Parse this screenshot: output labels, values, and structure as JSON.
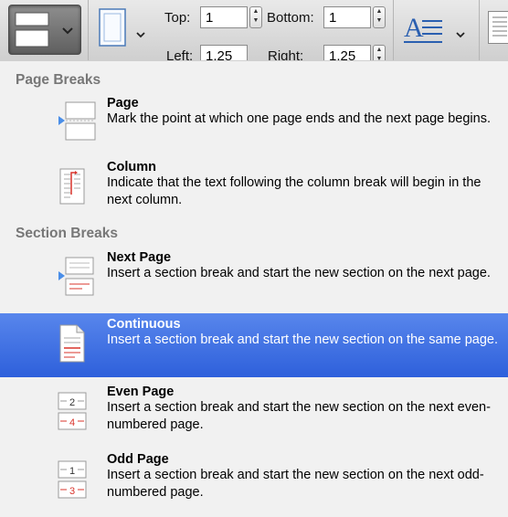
{
  "toolbar": {
    "top_label": "Top:",
    "top_value": "1",
    "bottom_label": "Bottom:",
    "bottom_value": "1",
    "left_label": "Left:",
    "left_value": "1.25",
    "right_label": "Right:",
    "right_value": "1.25"
  },
  "menu": {
    "page_breaks_header": "Page Breaks",
    "section_breaks_header": "Section Breaks",
    "items": [
      {
        "title": "Page",
        "desc": "Mark the point at which one page ends and the next page begins."
      },
      {
        "title": "Column",
        "desc": "Indicate that the text following the column break will begin in the next column."
      },
      {
        "title": "Next Page",
        "desc": "Insert a section break and start the new section on the next page."
      },
      {
        "title": "Continuous",
        "desc": "Insert a section break and start the new section on the same page."
      },
      {
        "title": "Even Page",
        "desc": "Insert a section break and start the new section on the next even-numbered page."
      },
      {
        "title": "Odd Page",
        "desc": "Insert a section break and start the new section on the next odd-numbered page."
      }
    ],
    "selected_index": 3,
    "selected_color": "#3a6ee0"
  },
  "icons": {
    "even_page_top": "2",
    "even_page_bottom": "4",
    "odd_page_top": "1",
    "odd_page_bottom": "3"
  }
}
